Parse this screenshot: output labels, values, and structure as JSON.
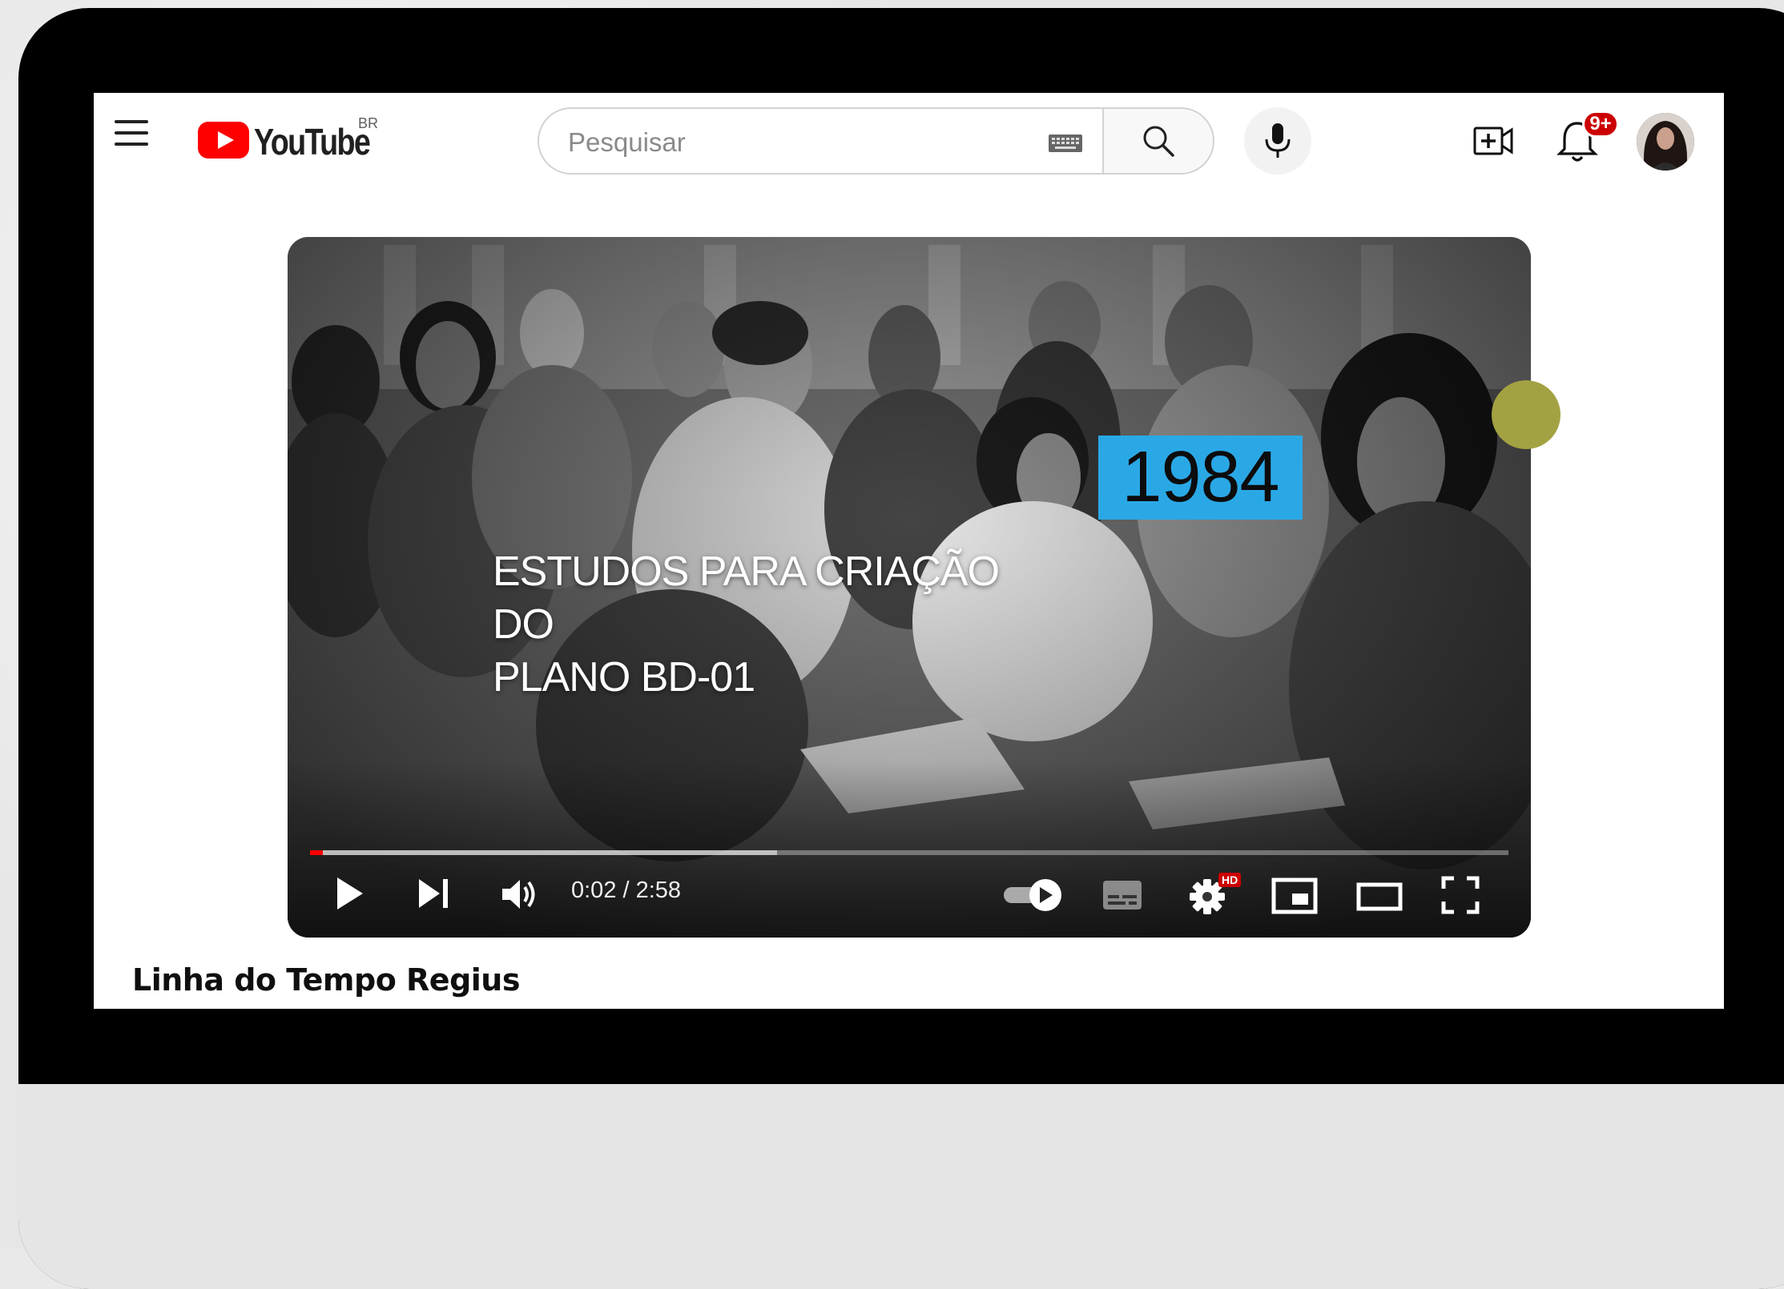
{
  "header": {
    "logo_text": "YouTube",
    "logo_region": "BR",
    "search_placeholder": "Pesquisar",
    "notification_badge": "9+"
  },
  "video": {
    "overlay_title_line1": "ESTUDOS PARA CRIAÇÃO DO",
    "overlay_title_line2": "PLANO BD-01",
    "year_badge": "1984",
    "time_display": "0:02 / 2:58",
    "hd_badge": "HD",
    "progress_played_fraction": 0.011,
    "progress_buffered_fraction": 0.39,
    "autoplay": true
  },
  "title": "Linha do Tempo Regius",
  "colors": {
    "brand_red": "#ff0000",
    "year_badge_bg": "#2aa8e6",
    "dot": "#a3a242"
  }
}
